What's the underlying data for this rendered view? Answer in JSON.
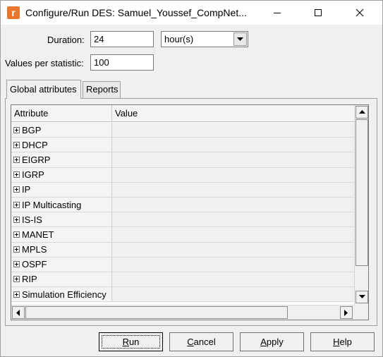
{
  "window": {
    "title": "Configure/Run DES: Samuel_Youssef_CompNet...",
    "app_icon_glyph": "r",
    "app_icon_color": "#e8762c"
  },
  "duration": {
    "label": "Duration:",
    "value": "24",
    "unit": "hour(s)"
  },
  "values_per_statistic": {
    "label": "Values per statistic:",
    "value": "100"
  },
  "tabs": [
    {
      "label": "Global attributes",
      "active": true
    },
    {
      "label": "Reports",
      "active": false
    }
  ],
  "grid": {
    "columns": [
      "Attribute",
      "Value"
    ],
    "rows": [
      {
        "attribute": "BGP",
        "value": ""
      },
      {
        "attribute": "DHCP",
        "value": ""
      },
      {
        "attribute": "EIGRP",
        "value": ""
      },
      {
        "attribute": "IGRP",
        "value": ""
      },
      {
        "attribute": "IP",
        "value": ""
      },
      {
        "attribute": "IP Multicasting",
        "value": ""
      },
      {
        "attribute": "IS-IS",
        "value": ""
      },
      {
        "attribute": "MANET",
        "value": ""
      },
      {
        "attribute": "MPLS",
        "value": ""
      },
      {
        "attribute": "OSPF",
        "value": ""
      },
      {
        "attribute": "RIP",
        "value": ""
      },
      {
        "attribute": "Simulation Efficiency",
        "value": ""
      }
    ]
  },
  "buttons": {
    "run": {
      "label": "Run",
      "mnemonic": "R",
      "rest": "un"
    },
    "cancel": {
      "label": "Cancel",
      "mnemonic": "C",
      "rest": "ancel"
    },
    "apply": {
      "label": "Apply",
      "mnemonic": "A",
      "rest": "pply"
    },
    "help": {
      "label": "Help",
      "mnemonic": "H",
      "rest": "elp"
    }
  }
}
